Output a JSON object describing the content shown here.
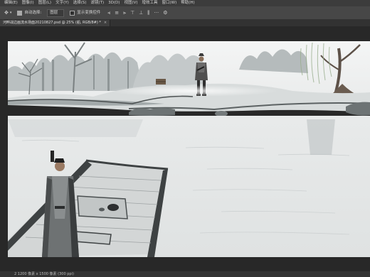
{
  "menu": {
    "items": [
      "编辑(E)",
      "图像(I)",
      "图层(L)",
      "文字(Y)",
      "选择(S)",
      "滤镜(T)",
      "3D(D)",
      "视图(V)",
      "增效工具",
      "窗口(W)",
      "帮助(H)"
    ]
  },
  "options": {
    "auto_select_label": "自动选择:",
    "layer_dropdown": "图层",
    "show_transform_label": "显示变换控件"
  },
  "document": {
    "tab_title": "河畔战边画流水场面20210827.psd @ 25% (船, RGB/8#) *",
    "close_glyph": "×"
  },
  "status": {
    "text": "2 1200 像素 x 1500 像素 (300 ppi)"
  },
  "colors": {
    "app_bg": "#282828",
    "menubar": "#3c3c3c",
    "options_bar": "#474747",
    "painting_sky": "#f3f4f4",
    "ink_dark": "#3a3a3a"
  },
  "icons": [
    "move-tool-icon",
    "align-left-icon",
    "align-center-icon",
    "align-right-icon",
    "distribute-icon",
    "more-options-icon",
    "settings-gear-icon"
  ]
}
